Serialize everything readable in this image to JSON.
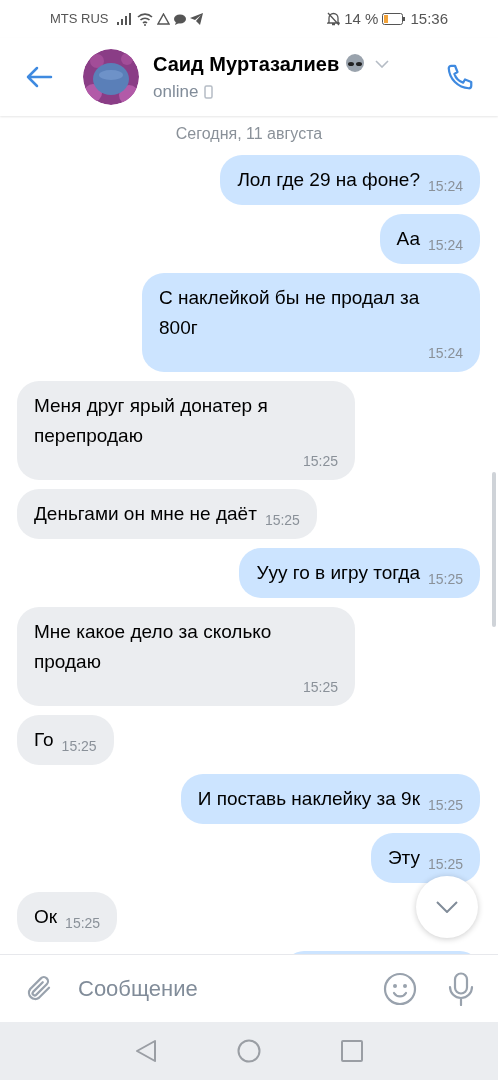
{
  "status_bar": {
    "carrier": "MTS RUS",
    "battery": "14 %",
    "time": "15:36"
  },
  "header": {
    "name": "Саид Муртазалиев",
    "status": "online"
  },
  "date_label": "Сегодня, 11 августа",
  "messages": [
    {
      "kind": "outgoing",
      "text": "Лол где 29 на фоне?",
      "time": "15:24"
    },
    {
      "kind": "outgoing",
      "text": "Аа",
      "time": "15:24"
    },
    {
      "kind": "outgoing",
      "text": "С наклейкой бы не продал за 800г",
      "time": "15:24"
    },
    {
      "kind": "incoming",
      "text": "Меня друг ярый донатер я перепродаю",
      "time": "15:25"
    },
    {
      "kind": "incoming",
      "text": "Деньгами он мне не даёт",
      "time": "15:25"
    },
    {
      "kind": "outgoing",
      "text": "Ууу го в игру тогда",
      "time": "15:25"
    },
    {
      "kind": "incoming",
      "text": "Мне какое дело за сколько продаю",
      "time": "15:25"
    },
    {
      "kind": "incoming",
      "text": "Го",
      "time": "15:25"
    },
    {
      "kind": "outgoing",
      "text": "И поставь наклейку за 9к",
      "time": "15:25"
    },
    {
      "kind": "outgoing",
      "text": "Эту",
      "time": "15:25"
    },
    {
      "kind": "incoming",
      "text": "Ок",
      "time": "15:25"
    },
    {
      "kind": "outgoing"
    }
  ],
  "composer": {
    "placeholder": "Сообщение"
  }
}
